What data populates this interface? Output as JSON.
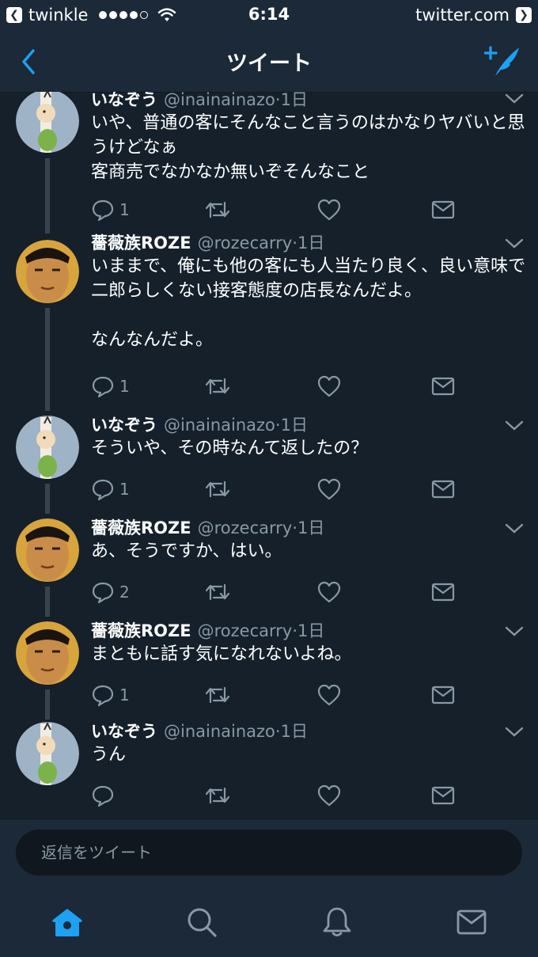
{
  "status_bar": {
    "app_back": "twinkle",
    "time": "6:14",
    "url": "twitter.com",
    "signal_filled": 4,
    "signal_total": 5
  },
  "nav": {
    "title": "ツイート",
    "back_icon": "chevron-left-icon",
    "compose_icon": "compose-tweet-icon",
    "accent": "#1da1f2"
  },
  "colors": {
    "background": "#15202b",
    "bar": "#1c2938",
    "secondary_text": "#8899a6",
    "accent": "#1da1f2"
  },
  "tweets": [
    {
      "name": "いなぞう",
      "handle": "@inainainazo",
      "time": "1日",
      "text": "いや、普通の客にそんなこと言うのはかなりヤバいと思うけどなぁ\n客商売でなかなか無いぞそんなこと",
      "reply_count": "1",
      "avatar": "inazo-avatar"
    },
    {
      "name": "薔薇族ROZE",
      "handle": "@rozecarry",
      "time": "1日",
      "text": "いままで、俺にも他の客にも人当たり良く、良い意味で二郎らしくない接客態度の店長なんだよ。\n\nなんなんだよ。",
      "reply_count": "1",
      "avatar": "roze-avatar"
    },
    {
      "name": "いなぞう",
      "handle": "@inainainazo",
      "time": "1日",
      "text": "そういや、その時なんて返したの？",
      "reply_count": "1",
      "avatar": "inazo-avatar"
    },
    {
      "name": "薔薇族ROZE",
      "handle": "@rozecarry",
      "time": "1日",
      "text": "あ、そうですか、はい。",
      "reply_count": "2",
      "avatar": "roze-avatar"
    },
    {
      "name": "薔薇族ROZE",
      "handle": "@rozecarry",
      "time": "1日",
      "text": "まともに話す気になれないよね。",
      "reply_count": "1",
      "avatar": "roze-avatar"
    },
    {
      "name": "いなぞう",
      "handle": "@inainainazo",
      "time": "1日",
      "text": "うん",
      "reply_count": "",
      "avatar": "inazo-avatar"
    }
  ],
  "reply": {
    "placeholder": "返信をツイート"
  },
  "tabs": [
    {
      "name": "home-icon",
      "active": true
    },
    {
      "name": "search-icon",
      "active": false
    },
    {
      "name": "notifications-icon",
      "active": false
    },
    {
      "name": "messages-icon",
      "active": false
    }
  ]
}
